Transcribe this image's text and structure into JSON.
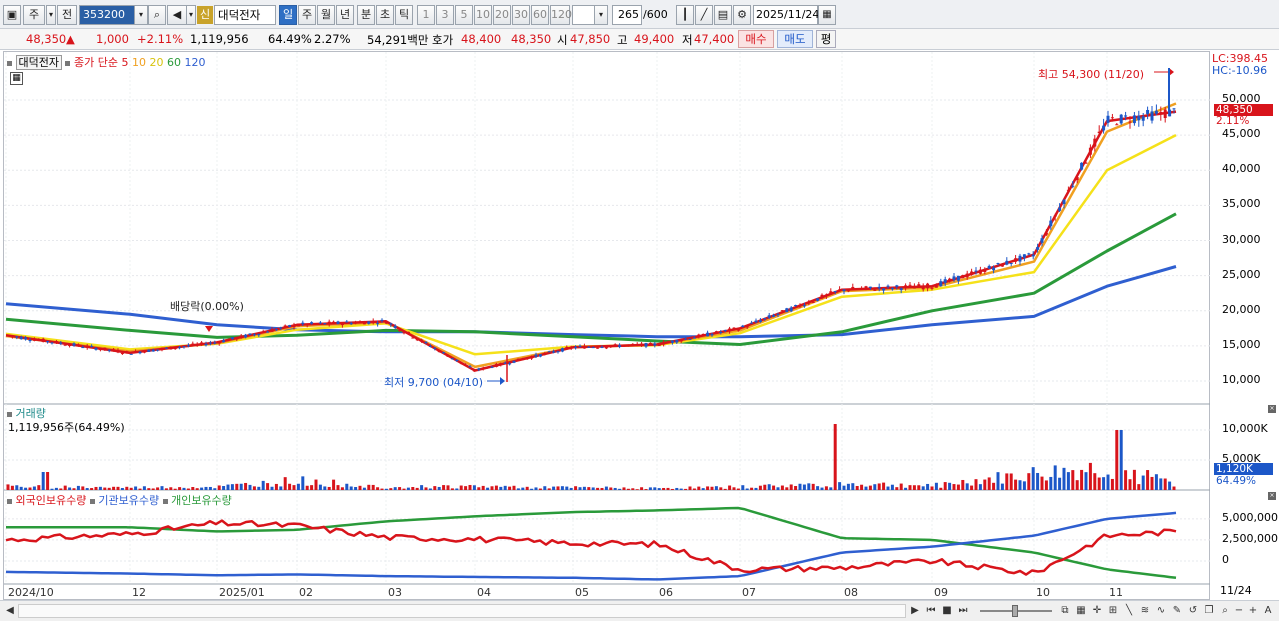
{
  "toolbar": {
    "market": "주",
    "type": "전",
    "code": "353200",
    "credit_badge": "신",
    "name": "대덕전자",
    "periods": [
      "일",
      "주",
      "월",
      "년",
      "분",
      "초",
      "틱"
    ],
    "selected_period": "일",
    "intervals": [
      "1",
      "3",
      "5",
      "10",
      "20",
      "30",
      "60",
      "120"
    ],
    "count": "265",
    "count_total": "/600",
    "date": "2025/11/24"
  },
  "quote": {
    "price": "48,350",
    "up_mark": "▲",
    "change": "1,000",
    "change_pct": "+2.11%",
    "volume": "1,119,956",
    "volume_ratio": "64.49%",
    "turnover": "2.27%",
    "amount": "54,291백만",
    "bid_label": "호가",
    "bid": "48,400",
    "ask": "48,350",
    "open_label": "시",
    "open": "47,850",
    "high_label": "고",
    "high": "49,400",
    "low_label": "저",
    "low": "47,400",
    "buy_label": "매수",
    "sell_label": "매도",
    "eval_label": "평"
  },
  "price_panel": {
    "legend_name": "대덕전자",
    "legend_ma_label": "종가 단순",
    "ma_periods": [
      "5",
      "10",
      "20",
      "60",
      "120"
    ],
    "ma_colors": [
      "#d8141b",
      "#f0a020",
      "#f5e11a",
      "#2a9a3a",
      "#2f5fd0"
    ],
    "lc_label": "LC:398.45",
    "hc_label": "HC:-10.96",
    "high_note": "최고 54,300 (11/20)",
    "low_note": "최저 9,700 (04/10)",
    "dividend_note": "배당락(0.00%)",
    "current_price_tag": "48,350",
    "current_pct_tag": "2.11%",
    "price_ticks": [
      "50,000",
      "45,000",
      "40,000",
      "35,000",
      "30,000",
      "25,000",
      "20,000",
      "15,000",
      "10,000"
    ]
  },
  "volume_panel": {
    "title": "거래량",
    "value": "1,119,956주(64.49%)",
    "ticks": [
      "10,000K",
      "5,000K"
    ],
    "current_tag": "1,120K",
    "current_pct": "64.49%"
  },
  "holdings_panel": {
    "legend": [
      "외국인보유수량",
      "기관보유수량",
      "개인보유수량"
    ],
    "colors": [
      "#d8141b",
      "#2f5fd0",
      "#2a9a3a"
    ],
    "ticks": [
      "5,000,000",
      "2,500,000",
      "0"
    ]
  },
  "x_axis": {
    "labels": [
      "2024/10",
      "12",
      "2025/01",
      "02",
      "03",
      "04",
      "05",
      "06",
      "07",
      "08",
      "09",
      "10",
      "11"
    ],
    "right_label": "11/24"
  },
  "colors": {
    "up": "#d8141b",
    "down": "#1c57c8",
    "accent": "#2e6fc4"
  },
  "chart_data": [
    {
      "type": "line",
      "title": "대덕전자 일봉",
      "x": [
        "2024/10",
        "12",
        "2025/01",
        "02",
        "03",
        "04",
        "05",
        "06",
        "07",
        "08",
        "09",
        "10",
        "11",
        "11/24"
      ],
      "series": [
        {
          "name": "5",
          "values": [
            16500,
            14000,
            15500,
            18000,
            18500,
            11500,
            14800,
            15200,
            17500,
            23000,
            23500,
            28000,
            47000,
            48350
          ]
        },
        {
          "name": "10",
          "values": [
            16400,
            14200,
            15400,
            17800,
            18400,
            12000,
            14800,
            15200,
            17200,
            22800,
            23300,
            27000,
            45500,
            49500
          ]
        },
        {
          "name": "20",
          "values": [
            16700,
            14500,
            15300,
            17300,
            18200,
            13800,
            14900,
            15100,
            16800,
            22000,
            23000,
            25500,
            40000,
            45000
          ]
        },
        {
          "name": "60",
          "values": [
            18800,
            17200,
            16200,
            16500,
            17200,
            17000,
            16300,
            15700,
            15200,
            17000,
            20000,
            22500,
            28500,
            33800
          ]
        },
        {
          "name": "120",
          "values": [
            21000,
            19500,
            18000,
            17300,
            17000,
            17000,
            16600,
            16300,
            16300,
            16600,
            18000,
            19200,
            23500,
            26300
          ]
        }
      ],
      "ylim": [
        8000,
        56000
      ],
      "annotations": [
        "최고 54,300 (11/20)",
        "최저 9,700 (04/10)",
        "배당락(0.00%)"
      ]
    },
    {
      "type": "bar",
      "title": "거래량",
      "x": [
        "2024/10",
        "12",
        "2025/01",
        "02",
        "03",
        "04",
        "05",
        "06",
        "07",
        "08",
        "09",
        "10",
        "11",
        "11/24"
      ],
      "values": [
        600,
        400,
        500,
        1500,
        500,
        600,
        400,
        300,
        500,
        1000,
        700,
        2500,
        3500,
        1120
      ],
      "ylabel": "K",
      "ylim": [
        0,
        12000
      ]
    },
    {
      "type": "line",
      "title": "보유수량",
      "x": [
        "2024/10",
        "12",
        "2025/01",
        "02",
        "03",
        "04",
        "05",
        "06",
        "07",
        "08",
        "09",
        "10",
        "11",
        "11/24"
      ],
      "series": [
        {
          "name": "외국인보유수량",
          "values": [
            2500000,
            3200000,
            4500000,
            4200000,
            2800000,
            2600000,
            2100000,
            2000000,
            -1000000,
            -800000,
            0,
            -1500000,
            3000000,
            3500000
          ]
        },
        {
          "name": "기관보유수량",
          "values": [
            -1300000,
            -1500000,
            -1700000,
            -1600000,
            -1800000,
            -1900000,
            -2000000,
            -2200000,
            -1800000,
            1000000,
            1700000,
            3000000,
            5000000,
            5700000
          ]
        },
        {
          "name": "개인보유수량",
          "values": [
            4000000,
            4000000,
            3500000,
            3700000,
            4700000,
            5300000,
            5800000,
            6000000,
            6300000,
            2700000,
            2500000,
            1000000,
            -1000000,
            -2000000
          ]
        }
      ],
      "ylim": [
        -2500000,
        7000000
      ]
    }
  ]
}
